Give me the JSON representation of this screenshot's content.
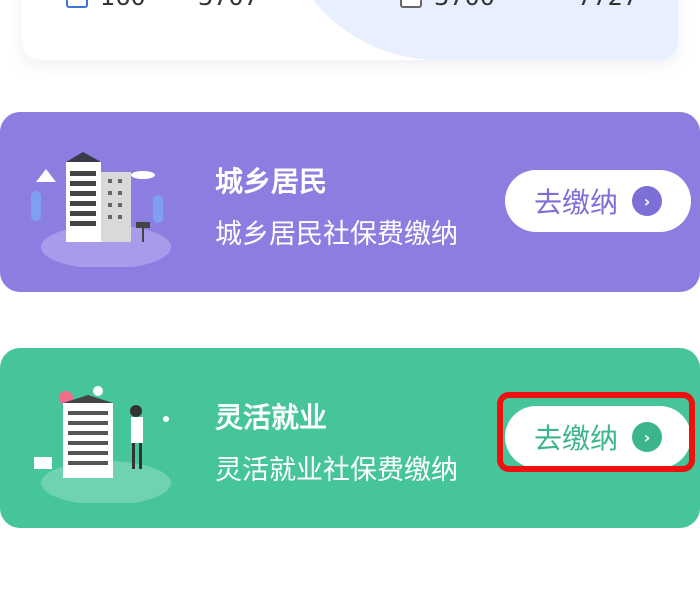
{
  "top_card": {
    "stat_left": {
      "icon": "document-icon",
      "text_a": "160",
      "text_b": "3707"
    },
    "stat_right": {
      "icon": "calendar-icon",
      "text_a": "3700",
      "text_b": "7727"
    }
  },
  "cards": [
    {
      "title": "城乡居民",
      "subtitle": "城乡居民社保费缴纳",
      "button_label": "去缴纳",
      "color": "#8b7ee0",
      "illustration": "apartment-building-icon"
    },
    {
      "title": "灵活就业",
      "subtitle": "灵活就业社保费缴纳",
      "button_label": "去缴纳",
      "color": "#46c49a",
      "illustration": "office-worker-building-icon"
    }
  ],
  "annotation": {
    "highlight_color": "#ee1111"
  }
}
